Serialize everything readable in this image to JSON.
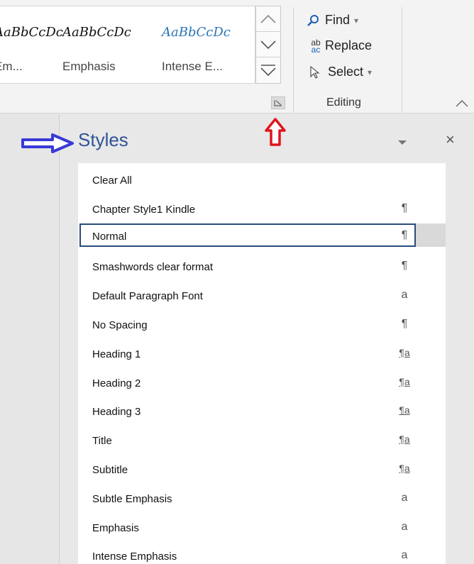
{
  "ribbon": {
    "gallery": [
      {
        "sample": "AaBbCcDc",
        "name": "Em..."
      },
      {
        "sample": "AaBbCcDc",
        "name": "Emphasis"
      },
      {
        "sample": "AaBbCcDc",
        "name": "Intense E..."
      }
    ],
    "editing": {
      "find": "Find",
      "replace": "Replace",
      "replace_icon_top": "ab",
      "replace_icon_bottom": "ac",
      "select": "Select",
      "group_label": "Editing"
    }
  },
  "styles_pane": {
    "title": "Styles",
    "close": "×",
    "items": [
      {
        "label": "Clear All",
        "mark": ""
      },
      {
        "label": "Chapter Style1 Kindle",
        "mark": "¶"
      },
      {
        "label": "Normal",
        "mark": "¶",
        "selected": true
      },
      {
        "label": "Smashwords clear format",
        "mark": "¶"
      },
      {
        "label": "Default Paragraph Font",
        "mark": "a"
      },
      {
        "label": "No Spacing",
        "mark": "¶"
      },
      {
        "label": "Heading 1",
        "mark": "¶a"
      },
      {
        "label": "Heading 2",
        "mark": "¶a"
      },
      {
        "label": "Heading 3",
        "mark": "¶a"
      },
      {
        "label": "Title",
        "mark": "¶a"
      },
      {
        "label": "Subtitle",
        "mark": "¶a"
      },
      {
        "label": "Subtle Emphasis",
        "mark": "a"
      },
      {
        "label": "Emphasis",
        "mark": "a"
      },
      {
        "label": "Intense Emphasis",
        "mark": "a"
      }
    ]
  },
  "colors": {
    "accent_blue": "#2f5496",
    "annotation_arrow_blue": "#3a3ad6",
    "annotation_arrow_red": "#e0141e",
    "selection_border": "#2b4b7b"
  },
  "icons": {
    "find": "magnifier-icon",
    "replace": "replace-ab-ac-icon",
    "select": "cursor-arrow-icon",
    "launcher": "dialog-launcher-icon",
    "pane_menu": "chevron-down-icon",
    "pane_close": "close-icon"
  }
}
